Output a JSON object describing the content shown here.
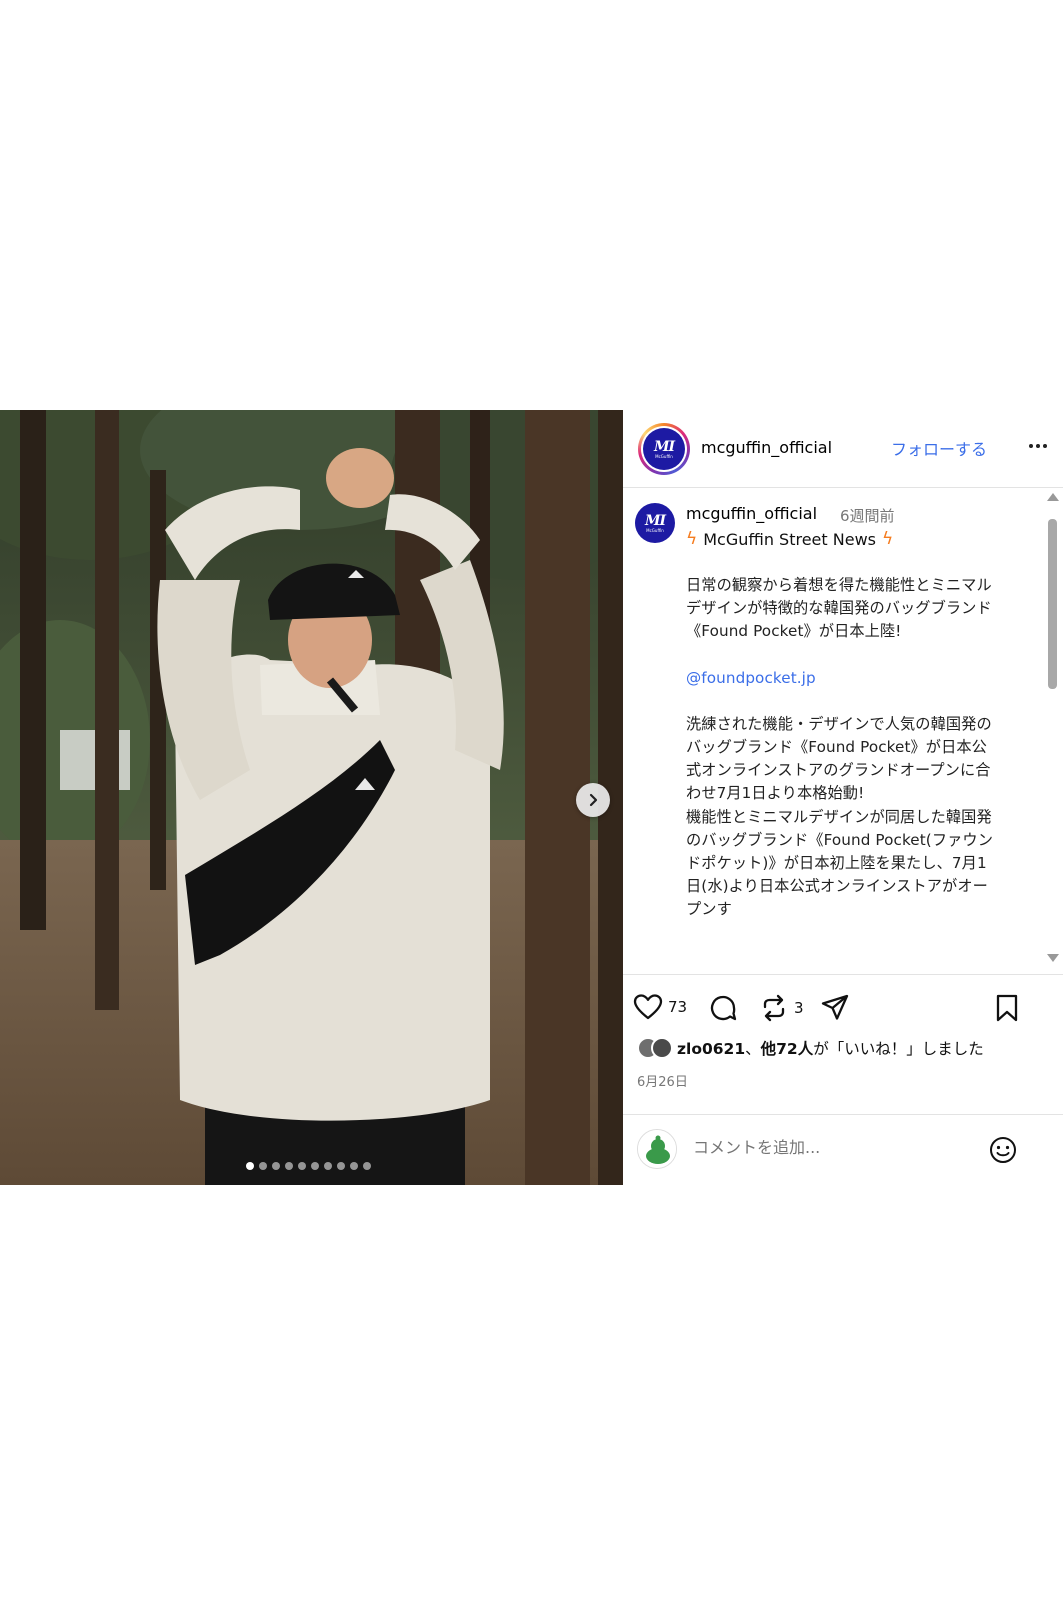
{
  "post": {
    "author": {
      "username": "mcguffin_official",
      "avatar_logo_mark": "MI",
      "avatar_logo_word": "McGuffin"
    },
    "follow_label": "フォローする",
    "more_icon": "more-horizontal-icon",
    "caption": {
      "username": "mcguffin_official",
      "time_ago": "6週間前",
      "subtitle_icon": "lightning-bolt-icon",
      "subtitle": "McGuffin Street News",
      "paragraphs": [
        "日常の観察から着想を得た機能性とミニマルデザインが特徴的な韓国発のバッグブランド《Found Pocket》が日本上陸!",
        "@foundpocket.jp",
        "洗練された機能・デザインで人気の韓国発のバッグブランド《Found Pocket》が日本公式オンラインストアのグランドオープンに合わせ7月1日より本格始動!",
        "機能性とミニマルデザインが同居した韓国発のバッグブランド《Found Pocket(ファウンドポケット)》が日本初上陸を果たし、7月1日(水)より日本公式オンラインストアがオープンす"
      ]
    },
    "actions": {
      "like_count": "73",
      "repost_count": "3"
    },
    "liked_by": {
      "user": "zlo0621",
      "others": "他72人",
      "suffix": "が「いいね！」しました"
    },
    "date": "6月26日",
    "comment_placeholder": "コメントを追加...",
    "carousel": {
      "slide_count": 10,
      "current_index": 0
    }
  },
  "colors": {
    "accent_link": "#3b6ee8",
    "brand_logo": "#1d1aa3",
    "bolt": "#f57c1f"
  }
}
